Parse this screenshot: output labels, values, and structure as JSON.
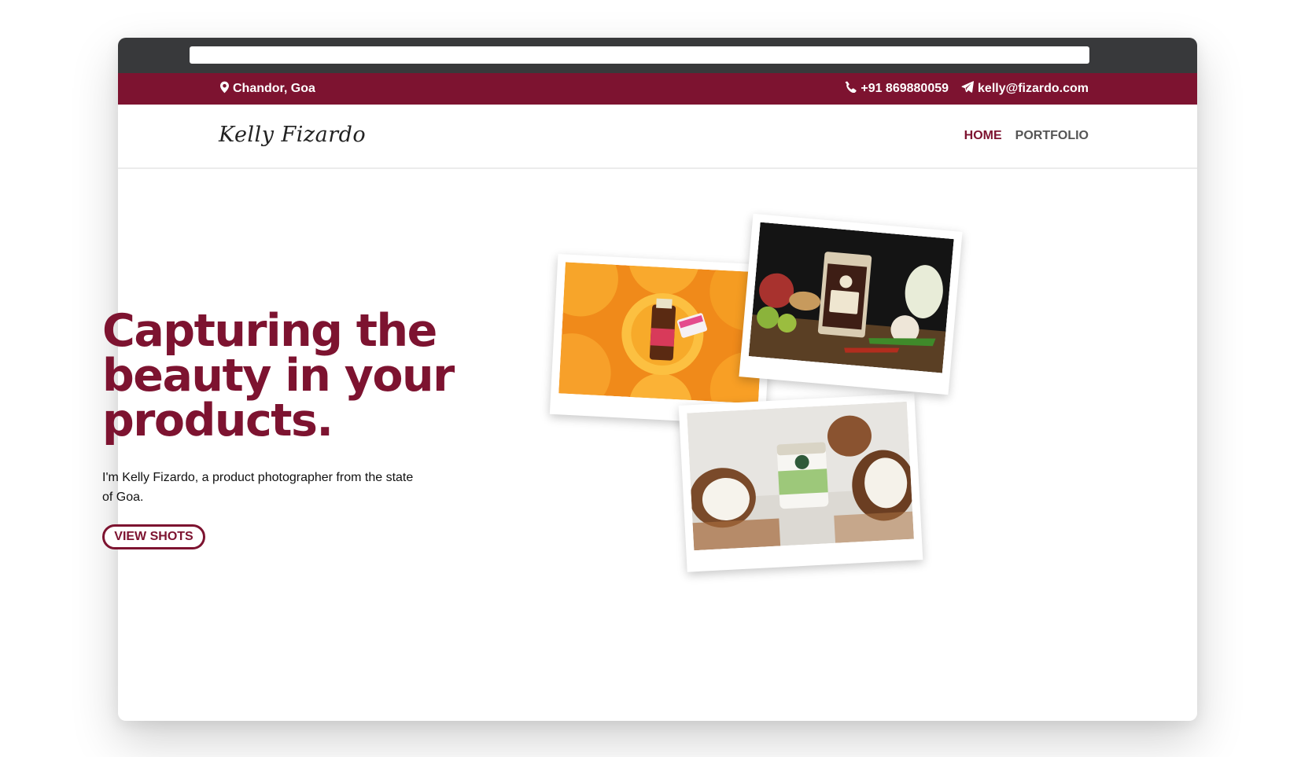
{
  "topbar": {
    "location": "Chandor, Goa",
    "phone": "+91 869880059",
    "email": "kelly@fizardo.com",
    "icons": [
      "map-marker-icon",
      "phone-icon",
      "paper-plane-icon"
    ]
  },
  "header": {
    "logo_text": "Kelly Fizardo",
    "nav": {
      "home": "HOME",
      "portfolio": "PORTFOLIO"
    }
  },
  "hero": {
    "headline": "Capturing the beauty in your products.",
    "subtext": "I'm Kelly Fizardo, a product photographer from the state of Goa.",
    "button_label": "VIEW SHOTS"
  },
  "colors": {
    "brand": "#7d1330",
    "chrome": "#38393b",
    "nav_inactive": "#555555"
  }
}
